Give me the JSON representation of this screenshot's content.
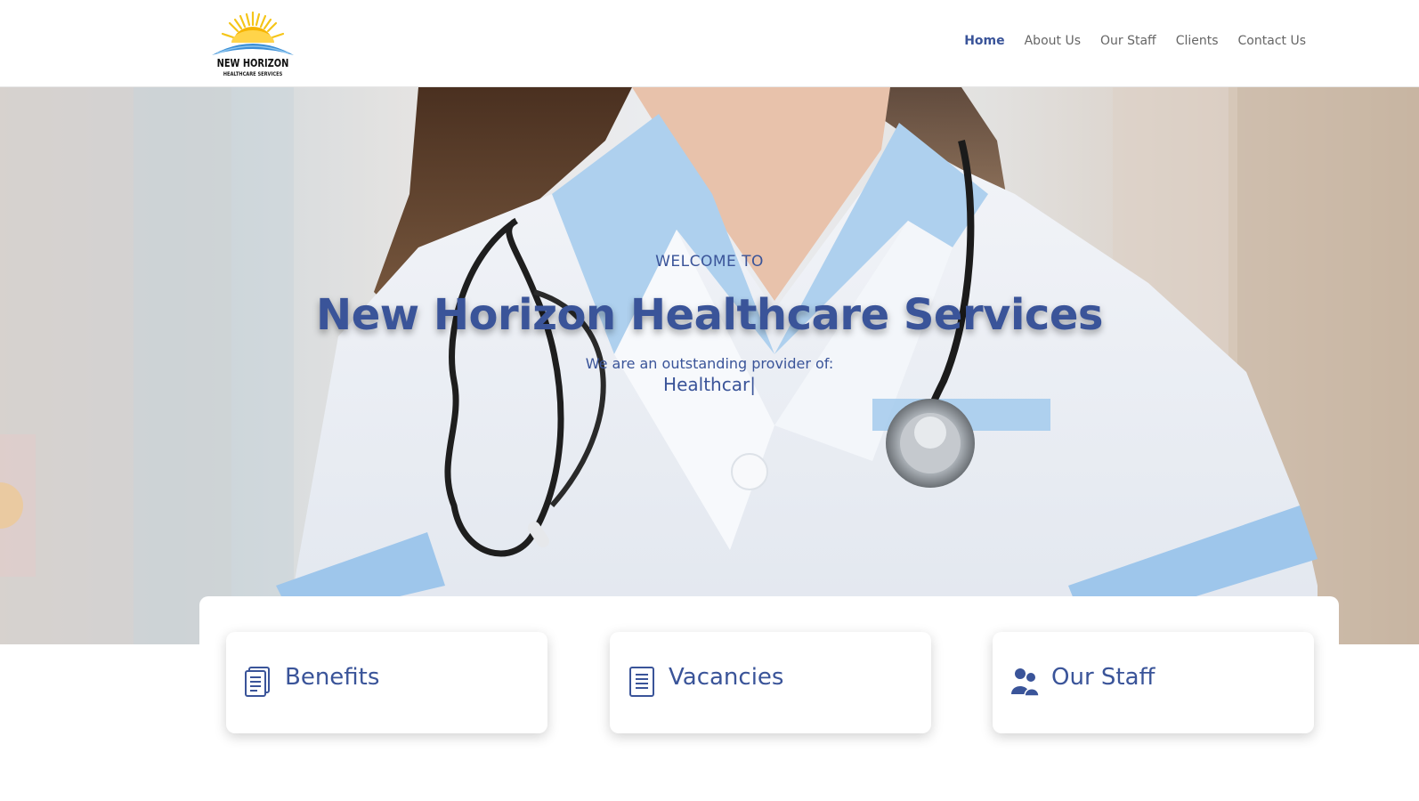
{
  "logo": {
    "title": "NEW HORIZON",
    "subtitle": "HEALTHCARE SERVICES"
  },
  "nav": {
    "items": [
      {
        "label": "Home",
        "active": true
      },
      {
        "label": "About Us",
        "active": false
      },
      {
        "label": "Our Staff",
        "active": false
      },
      {
        "label": "Clients",
        "active": false
      },
      {
        "label": "Contact Us",
        "active": false
      }
    ]
  },
  "hero": {
    "welcome": "WELCOME TO",
    "title": "New Horizon Healthcare Services",
    "provider_text": "We are an outstanding provider of:",
    "typed_text": "Healthcar",
    "typed_cursor": "|"
  },
  "cards": [
    {
      "label": "Benefits",
      "icon": "document-list-icon"
    },
    {
      "label": "Vacancies",
      "icon": "document-icon"
    },
    {
      "label": "Our Staff",
      "icon": "users-icon"
    }
  ],
  "colors": {
    "brand_blue": "#3a5499",
    "nav_text": "#666666",
    "sun_yellow": "#f5c518",
    "horizon_blue": "#3b8fd6"
  }
}
